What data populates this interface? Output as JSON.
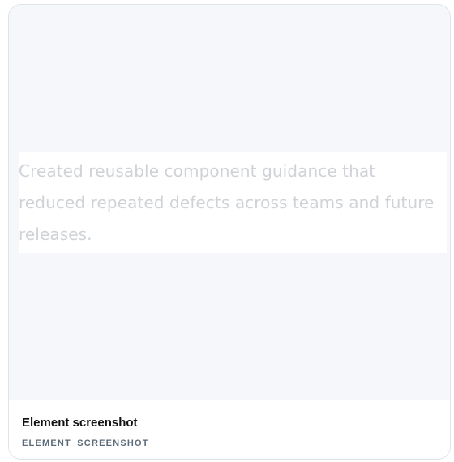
{
  "preview": {
    "snippet_text": "Created reusable component guidance that reduced repeated defects across teams and future releases."
  },
  "footer": {
    "title": "Element screenshot",
    "identifier": "ELEMENT_SCREENSHOT"
  }
}
